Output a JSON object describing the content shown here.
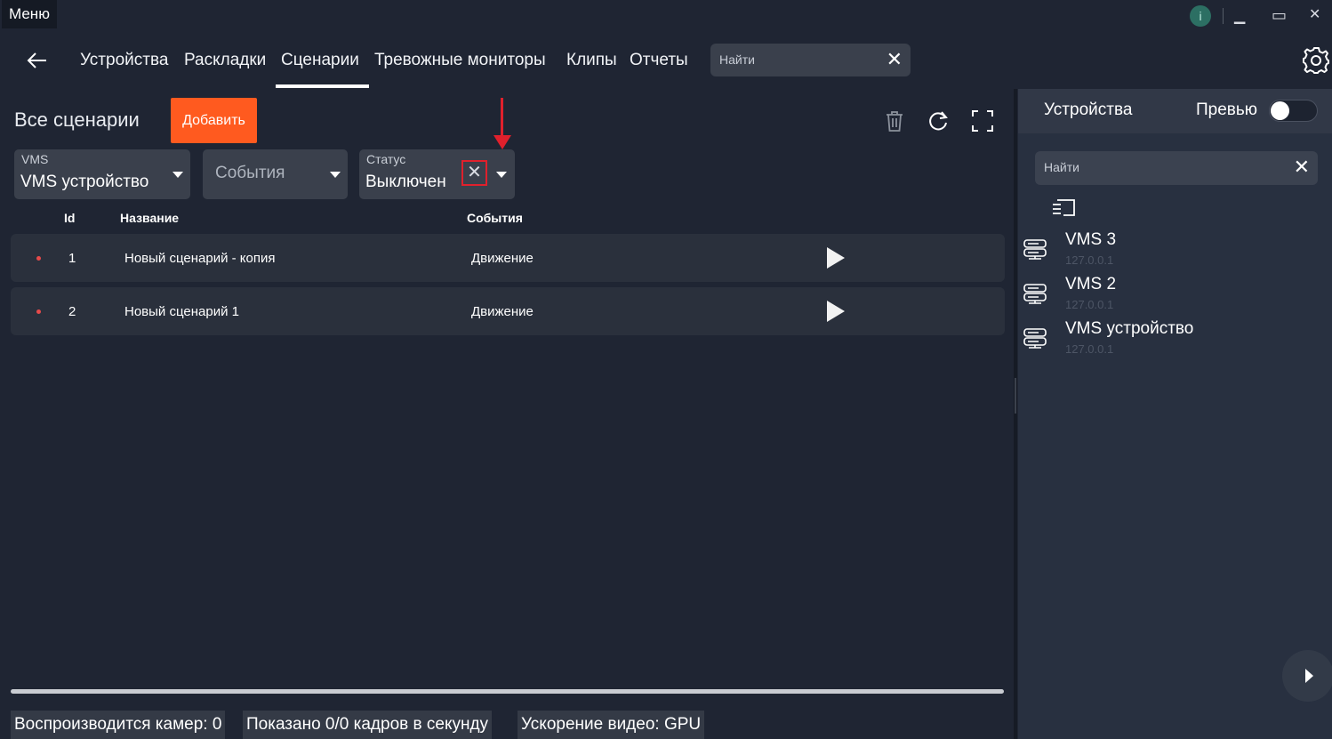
{
  "titlebar": {
    "menu_label": "Меню",
    "info_icon": "info-icon",
    "minimize": "▁",
    "maximize": "▭",
    "close": "✕"
  },
  "nav": {
    "back_icon": "arrow-left-icon",
    "tabs": [
      {
        "label": "Устройства"
      },
      {
        "label": "Раскладки"
      },
      {
        "label": "Сценарии",
        "active": true
      },
      {
        "label": "Тревожные мониторы"
      },
      {
        "label": "Клипы"
      },
      {
        "label": "Отчеты"
      }
    ],
    "search_placeholder": "Найти",
    "search_clear": "✕",
    "settings_icon": "gear-icon"
  },
  "scenarios": {
    "title": "Все сценарии",
    "add_label": "Добавить",
    "toolbar_icons": [
      "trash-icon",
      "refresh-icon",
      "fullscreen-icon"
    ],
    "filters": {
      "vms": {
        "label": "VMS",
        "value": "VMS устройство"
      },
      "events": {
        "placeholder": "События"
      },
      "status": {
        "label": "Статус",
        "value": "Выключен",
        "clear": "✕"
      }
    },
    "columns": {
      "id": "Id",
      "name": "Название",
      "events": "События"
    },
    "rows": [
      {
        "id": "1",
        "name": "Новый сценарий - копия",
        "events": "Движение"
      },
      {
        "id": "2",
        "name": "Новый сценарий 1",
        "events": "Движение"
      }
    ],
    "accent_color": "#ff5a1f",
    "status_dot_color": "#e74a4a",
    "highlight_color": "#e0202c"
  },
  "statusbar": {
    "cameras": "Воспроизводится камер: 0",
    "fps": "Показано 0/0 кадров в секунду",
    "accel": "Ускорение видео: GPU"
  },
  "devices_panel": {
    "title": "Устройства",
    "preview_label": "Превью",
    "preview_on": false,
    "search_placeholder": "Найти",
    "search_clear": "✕",
    "group_icon": "folder-list-icon",
    "devices": [
      {
        "name": "VMS 3",
        "ip": "127.0.0.1"
      },
      {
        "name": "VMS 2",
        "ip": "127.0.0.1"
      },
      {
        "name": "VMS устройство",
        "ip": "127.0.0.1"
      }
    ]
  }
}
